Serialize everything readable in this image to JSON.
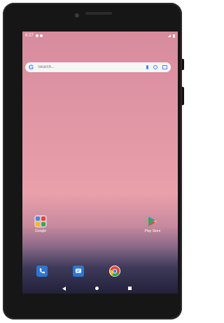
{
  "status_bar": {
    "time": "6:27"
  },
  "search": {
    "logo": "G",
    "placeholder": "Search..."
  },
  "apps": [
    {
      "label": "Google",
      "icon": "folder-icon"
    },
    {
      "label": "Play Store",
      "icon": "play-store-icon"
    }
  ],
  "dock": [
    {
      "icon": "phone-icon",
      "color": "#2b77d3"
    },
    {
      "icon": "messages-icon",
      "color": "#2b77d3"
    },
    {
      "icon": "chrome-icon",
      "color": "#ffffff"
    }
  ],
  "colors": {
    "accent": "#4285f4",
    "wallpaper_top": "#d78b9e",
    "wallpaper_bottom": "#22203a"
  }
}
